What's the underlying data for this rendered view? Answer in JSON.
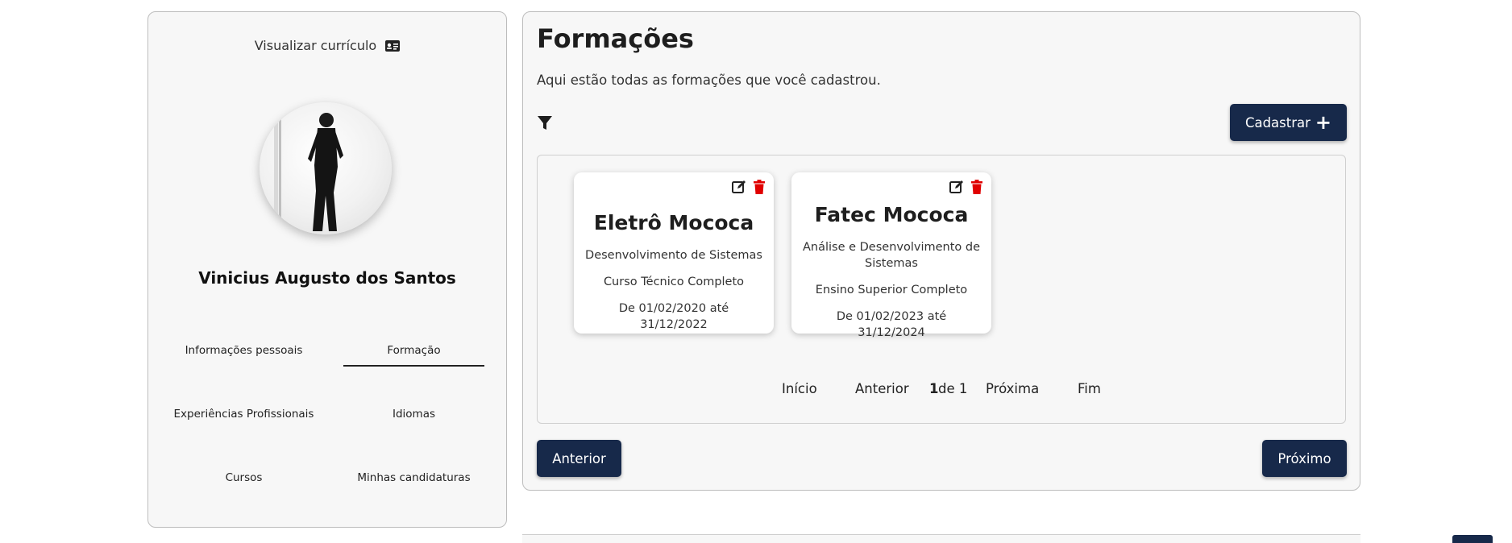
{
  "sidebar": {
    "view_cv": "Visualizar currículo",
    "user_name": "Vinicius Augusto dos Santos",
    "nav": [
      {
        "label": "Informações pessoais"
      },
      {
        "label": "Formação"
      },
      {
        "label": "Experiências Profissionais"
      },
      {
        "label": "Idiomas"
      },
      {
        "label": "Cursos"
      },
      {
        "label": "Minhas candidaturas"
      }
    ]
  },
  "main": {
    "title": "Formações",
    "subtitle": "Aqui estão todas as formações que você cadastrou.",
    "register_label": "Cadastrar",
    "cards": [
      {
        "institution": "Eletrô Mococa",
        "course": "Desenvolvimento de Sistemas",
        "level": "Curso Técnico Completo",
        "period": "De 01/02/2020 até 31/12/2022"
      },
      {
        "institution": "Fatec Mococa",
        "course": "Análise e Desenvolvimento de Sistemas",
        "level": "Ensino Superior Completo",
        "period": "De 01/02/2023 até 31/12/2024"
      }
    ],
    "pagination": {
      "first": "Início",
      "prev": "Anterior",
      "current": "1",
      "of": "de 1",
      "next": "Próxima",
      "last": "Fim"
    },
    "prev_button": "Anterior",
    "next_button": "Próximo"
  },
  "colors": {
    "primary": "#17294a",
    "delete": "#e00000",
    "background": "#f7f7f7"
  }
}
